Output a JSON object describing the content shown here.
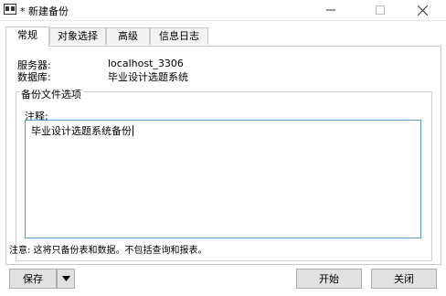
{
  "window": {
    "title": "* 新建备份",
    "icons": [
      "backup-app-icon",
      "minimize-icon",
      "maximize-icon",
      "close-icon"
    ]
  },
  "tabs": [
    {
      "label": "常规",
      "active": true
    },
    {
      "label": "对象选择",
      "active": false
    },
    {
      "label": "高级",
      "active": false
    },
    {
      "label": "信息日志",
      "active": false
    }
  ],
  "general": {
    "server_label": "服务器:",
    "server_value": "localhost_3306",
    "database_label": "数据库:",
    "database_value": "毕业设计选题系统"
  },
  "backup_options": {
    "group_title": "备份文件选项",
    "comment_label": "注释:",
    "comment_value": "毕业设计选题系统备份"
  },
  "footer_note": "注意: 这将只备份表和数据。不包括查询和报表。",
  "buttons": {
    "save": "保存",
    "start": "开始",
    "close": "关闭"
  },
  "colors": {
    "input_focus_border": "#5b9bd5",
    "button_bg": "#e1e1e1"
  }
}
